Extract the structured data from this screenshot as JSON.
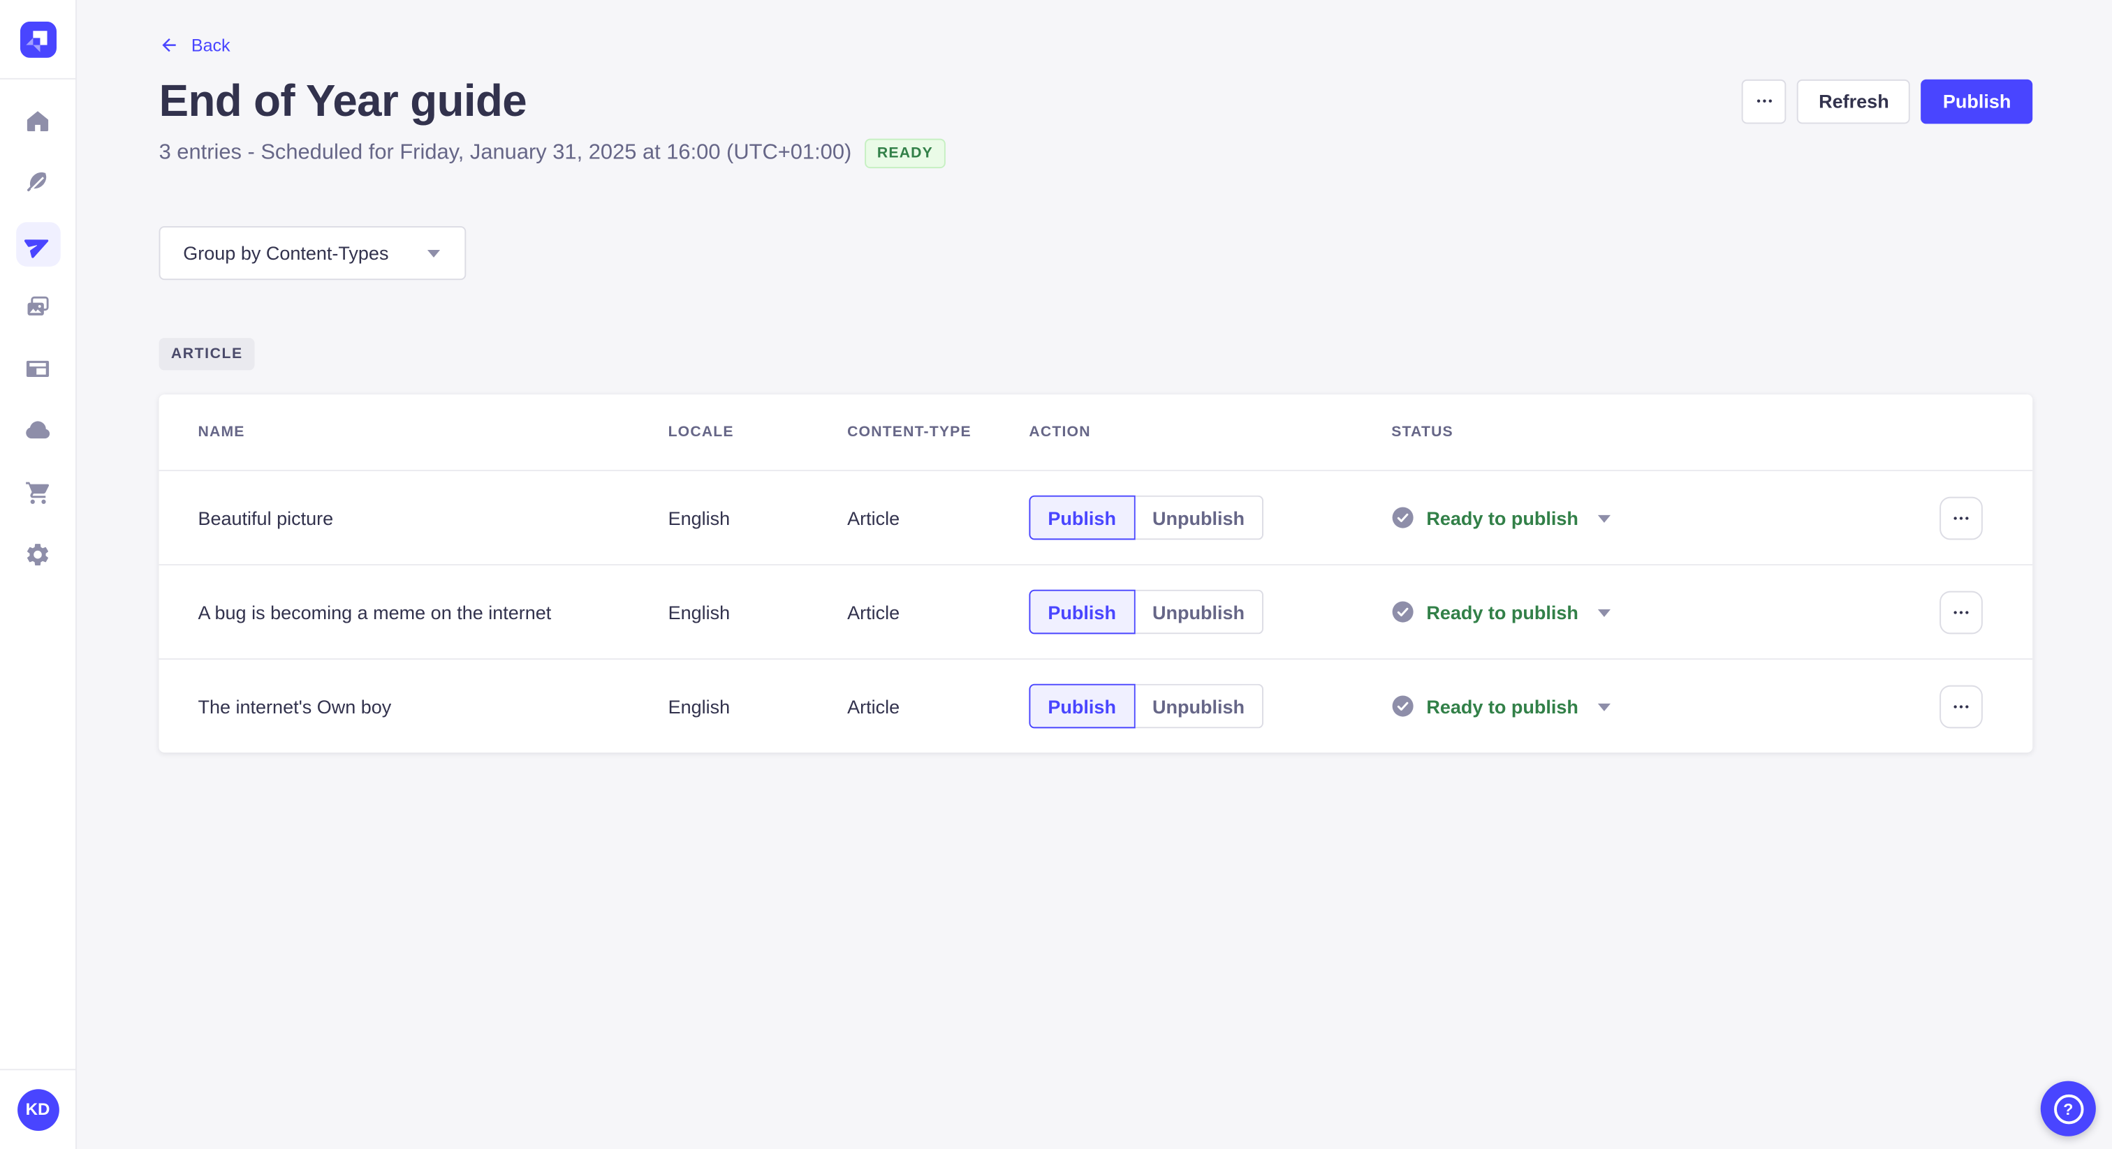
{
  "colors": {
    "primary": "#4945ff",
    "primary_bg": "#f0f0ff",
    "page_bg": "#f6f6f9",
    "success_text": "#328048",
    "success_bg": "#eafbe7",
    "success_border": "#c6f0c2",
    "text_dark": "#32324d",
    "text_muted": "#666687",
    "border": "#dcdce4",
    "border_light": "#eaeaef",
    "icon_gray": "#8e8ea9"
  },
  "sidebar": {
    "avatar_initials": "KD",
    "items": [
      {
        "id": "home",
        "icon": "home-icon",
        "active": false
      },
      {
        "id": "content-manager",
        "icon": "feather-icon",
        "active": false
      },
      {
        "id": "releases",
        "icon": "paper-plane-icon",
        "active": true
      },
      {
        "id": "media-library",
        "icon": "pictures-icon",
        "active": false
      },
      {
        "id": "content-type-builder",
        "icon": "layout-icon",
        "active": false
      },
      {
        "id": "cloud",
        "icon": "cloud-icon",
        "active": false
      },
      {
        "id": "marketplace",
        "icon": "cart-icon",
        "active": false
      },
      {
        "id": "settings",
        "icon": "gear-icon",
        "active": false
      }
    ]
  },
  "header": {
    "back_label": "Back",
    "title": "End of Year guide",
    "subtitle": "3 entries - Scheduled for Friday, January 31, 2025 at 16:00 (UTC+01:00)",
    "status_badge": "READY",
    "refresh_label": "Refresh",
    "publish_label": "Publish"
  },
  "toolbar": {
    "group_by_label": "Group by Content-Types"
  },
  "group": {
    "tag": "ARTICLE"
  },
  "table": {
    "columns": [
      "NAME",
      "LOCALE",
      "CONTENT-TYPE",
      "ACTION",
      "STATUS"
    ],
    "action_labels": {
      "publish": "Publish",
      "unpublish": "Unpublish"
    },
    "rows": [
      {
        "name": "Beautiful picture",
        "locale": "English",
        "content_type": "Article",
        "status": "Ready to publish"
      },
      {
        "name": "A bug is becoming a meme on the internet",
        "locale": "English",
        "content_type": "Article",
        "status": "Ready to publish"
      },
      {
        "name": "The internet's Own boy",
        "locale": "English",
        "content_type": "Article",
        "status": "Ready to publish"
      }
    ]
  }
}
